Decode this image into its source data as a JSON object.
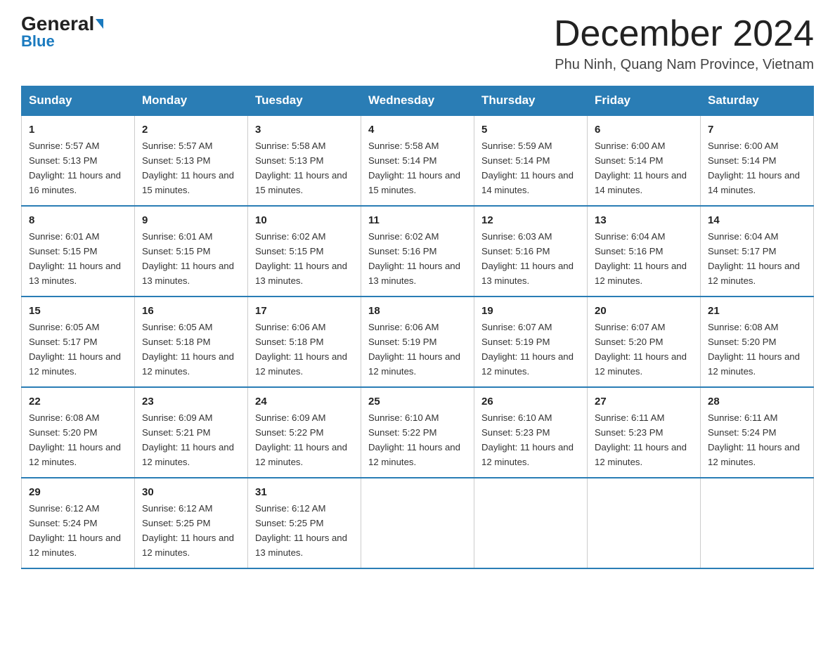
{
  "header": {
    "logo_general": "General",
    "logo_blue": "Blue",
    "month_title": "December 2024",
    "location": "Phu Ninh, Quang Nam Province, Vietnam"
  },
  "weekdays": [
    "Sunday",
    "Monday",
    "Tuesday",
    "Wednesday",
    "Thursday",
    "Friday",
    "Saturday"
  ],
  "weeks": [
    [
      {
        "day": "1",
        "sunrise": "5:57 AM",
        "sunset": "5:13 PM",
        "daylight": "11 hours and 16 minutes."
      },
      {
        "day": "2",
        "sunrise": "5:57 AM",
        "sunset": "5:13 PM",
        "daylight": "11 hours and 15 minutes."
      },
      {
        "day": "3",
        "sunrise": "5:58 AM",
        "sunset": "5:13 PM",
        "daylight": "11 hours and 15 minutes."
      },
      {
        "day": "4",
        "sunrise": "5:58 AM",
        "sunset": "5:14 PM",
        "daylight": "11 hours and 15 minutes."
      },
      {
        "day": "5",
        "sunrise": "5:59 AM",
        "sunset": "5:14 PM",
        "daylight": "11 hours and 14 minutes."
      },
      {
        "day": "6",
        "sunrise": "6:00 AM",
        "sunset": "5:14 PM",
        "daylight": "11 hours and 14 minutes."
      },
      {
        "day": "7",
        "sunrise": "6:00 AM",
        "sunset": "5:14 PM",
        "daylight": "11 hours and 14 minutes."
      }
    ],
    [
      {
        "day": "8",
        "sunrise": "6:01 AM",
        "sunset": "5:15 PM",
        "daylight": "11 hours and 13 minutes."
      },
      {
        "day": "9",
        "sunrise": "6:01 AM",
        "sunset": "5:15 PM",
        "daylight": "11 hours and 13 minutes."
      },
      {
        "day": "10",
        "sunrise": "6:02 AM",
        "sunset": "5:15 PM",
        "daylight": "11 hours and 13 minutes."
      },
      {
        "day": "11",
        "sunrise": "6:02 AM",
        "sunset": "5:16 PM",
        "daylight": "11 hours and 13 minutes."
      },
      {
        "day": "12",
        "sunrise": "6:03 AM",
        "sunset": "5:16 PM",
        "daylight": "11 hours and 13 minutes."
      },
      {
        "day": "13",
        "sunrise": "6:04 AM",
        "sunset": "5:16 PM",
        "daylight": "11 hours and 12 minutes."
      },
      {
        "day": "14",
        "sunrise": "6:04 AM",
        "sunset": "5:17 PM",
        "daylight": "11 hours and 12 minutes."
      }
    ],
    [
      {
        "day": "15",
        "sunrise": "6:05 AM",
        "sunset": "5:17 PM",
        "daylight": "11 hours and 12 minutes."
      },
      {
        "day": "16",
        "sunrise": "6:05 AM",
        "sunset": "5:18 PM",
        "daylight": "11 hours and 12 minutes."
      },
      {
        "day": "17",
        "sunrise": "6:06 AM",
        "sunset": "5:18 PM",
        "daylight": "11 hours and 12 minutes."
      },
      {
        "day": "18",
        "sunrise": "6:06 AM",
        "sunset": "5:19 PM",
        "daylight": "11 hours and 12 minutes."
      },
      {
        "day": "19",
        "sunrise": "6:07 AM",
        "sunset": "5:19 PM",
        "daylight": "11 hours and 12 minutes."
      },
      {
        "day": "20",
        "sunrise": "6:07 AM",
        "sunset": "5:20 PM",
        "daylight": "11 hours and 12 minutes."
      },
      {
        "day": "21",
        "sunrise": "6:08 AM",
        "sunset": "5:20 PM",
        "daylight": "11 hours and 12 minutes."
      }
    ],
    [
      {
        "day": "22",
        "sunrise": "6:08 AM",
        "sunset": "5:20 PM",
        "daylight": "11 hours and 12 minutes."
      },
      {
        "day": "23",
        "sunrise": "6:09 AM",
        "sunset": "5:21 PM",
        "daylight": "11 hours and 12 minutes."
      },
      {
        "day": "24",
        "sunrise": "6:09 AM",
        "sunset": "5:22 PM",
        "daylight": "11 hours and 12 minutes."
      },
      {
        "day": "25",
        "sunrise": "6:10 AM",
        "sunset": "5:22 PM",
        "daylight": "11 hours and 12 minutes."
      },
      {
        "day": "26",
        "sunrise": "6:10 AM",
        "sunset": "5:23 PM",
        "daylight": "11 hours and 12 minutes."
      },
      {
        "day": "27",
        "sunrise": "6:11 AM",
        "sunset": "5:23 PM",
        "daylight": "11 hours and 12 minutes."
      },
      {
        "day": "28",
        "sunrise": "6:11 AM",
        "sunset": "5:24 PM",
        "daylight": "11 hours and 12 minutes."
      }
    ],
    [
      {
        "day": "29",
        "sunrise": "6:12 AM",
        "sunset": "5:24 PM",
        "daylight": "11 hours and 12 minutes."
      },
      {
        "day": "30",
        "sunrise": "6:12 AM",
        "sunset": "5:25 PM",
        "daylight": "11 hours and 12 minutes."
      },
      {
        "day": "31",
        "sunrise": "6:12 AM",
        "sunset": "5:25 PM",
        "daylight": "11 hours and 13 minutes."
      },
      null,
      null,
      null,
      null
    ]
  ]
}
